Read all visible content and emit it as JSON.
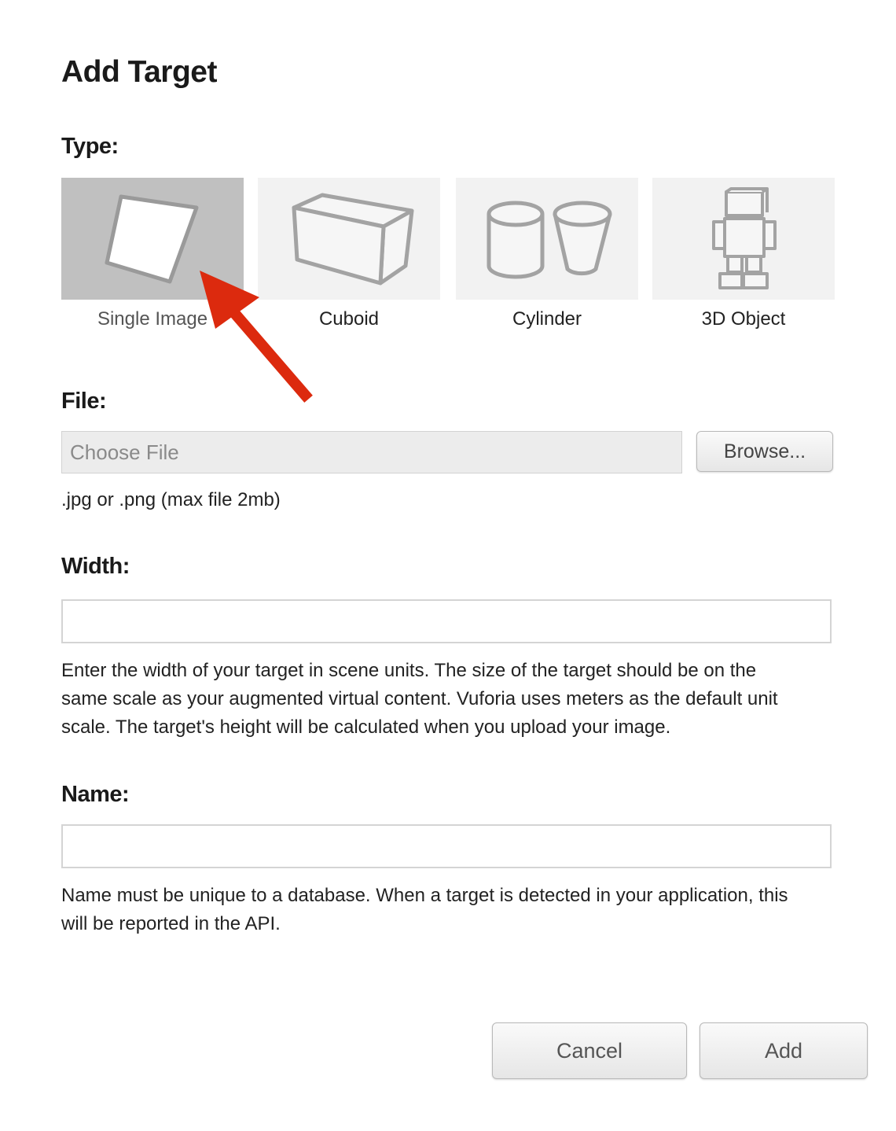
{
  "dialog": {
    "title": "Add Target"
  },
  "type_section": {
    "label": "Type:",
    "selected": "single-image",
    "options": [
      {
        "id": "single-image",
        "label": "Single Image",
        "icon": "single-image-icon"
      },
      {
        "id": "cuboid",
        "label": "Cuboid",
        "icon": "cuboid-icon"
      },
      {
        "id": "cylinder",
        "label": "Cylinder",
        "icon": "cylinder-icon"
      },
      {
        "id": "3d-object",
        "label": "3D Object",
        "icon": "3d-object-icon"
      }
    ]
  },
  "file_section": {
    "label": "File:",
    "placeholder": "Choose File",
    "browse_label": "Browse...",
    "hint": ".jpg or .png (max file 2mb)"
  },
  "width_section": {
    "label": "Width:",
    "value": "",
    "hint_lines": [
      "Enter the width of your target in scene units. The size of the target should be on the",
      "same scale as your augmented virtual content. Vuforia uses meters as the default unit",
      "scale. The target's height will be calculated when you upload your image."
    ]
  },
  "name_section": {
    "label": "Name:",
    "value": "",
    "hint_lines": [
      "Name must be unique to a database. When a target is detected in your application, this",
      "will be reported in the API."
    ]
  },
  "actions": {
    "cancel_label": "Cancel",
    "add_label": "Add"
  },
  "annotation": {
    "arrow_color": "#dc2a0e",
    "arrow_icon": "red-arrow-icon"
  },
  "colors": {
    "selected_tile": "#c0c0c0",
    "tile": "#f2f2f2",
    "icon_stroke": "#9a9a9a"
  }
}
